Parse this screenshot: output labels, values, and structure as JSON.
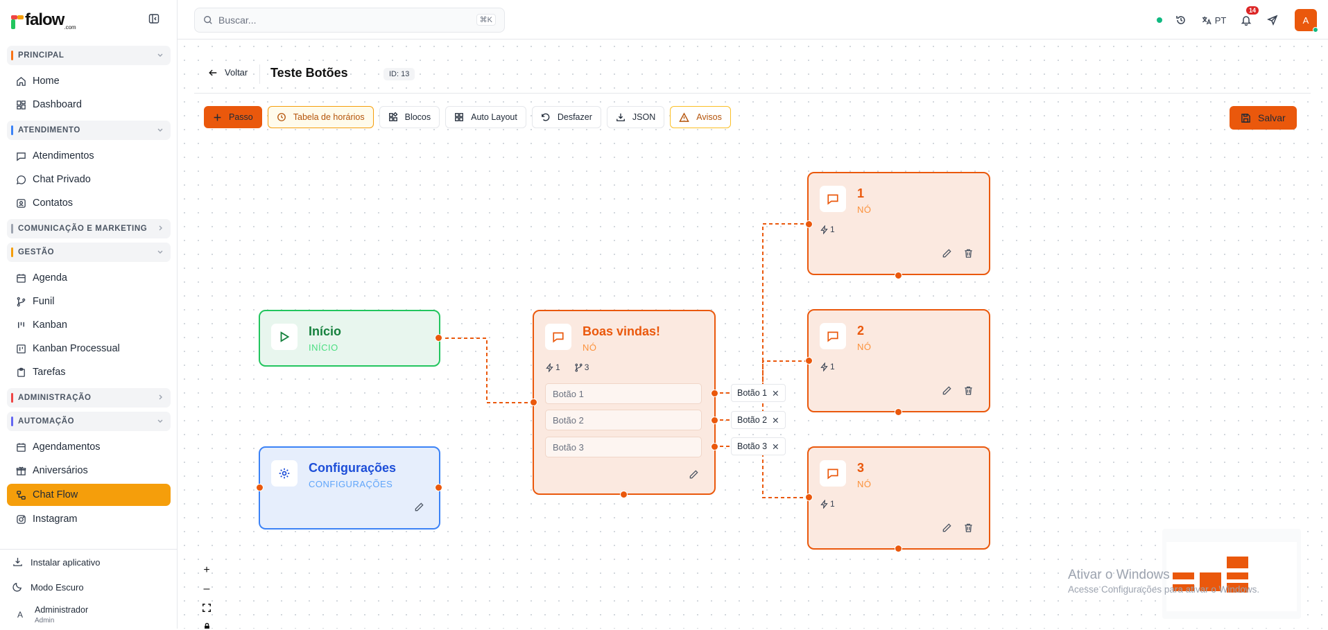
{
  "app": {
    "logo": "falow",
    "logo_suffix": ".com"
  },
  "sidebar": {
    "groups": [
      {
        "label": "PRINCIPAL",
        "color": "#f97316",
        "items": [
          {
            "label": "Home",
            "icon": "home-icon"
          },
          {
            "label": "Dashboard",
            "icon": "dashboard-icon"
          }
        ]
      },
      {
        "label": "ATENDIMENTO",
        "color": "#3b82f6",
        "items": [
          {
            "label": "Atendimentos",
            "icon": "message-square-icon"
          },
          {
            "label": "Chat Privado",
            "icon": "message-circle-icon"
          },
          {
            "label": "Contatos",
            "icon": "contacts-icon"
          }
        ]
      },
      {
        "label": "COMUNICAÇÃO E MARKETING",
        "color": "#9ca3af",
        "items": []
      },
      {
        "label": "GESTÃO",
        "color": "#f59e0b",
        "items": [
          {
            "label": "Agenda",
            "icon": "calendar-icon"
          },
          {
            "label": "Funil",
            "icon": "git-branch-icon"
          },
          {
            "label": "Kanban",
            "icon": "kanban-icon"
          },
          {
            "label": "Kanban Processual",
            "icon": "kanban-board-icon"
          },
          {
            "label": "Tarefas",
            "icon": "clipboard-icon"
          }
        ]
      },
      {
        "label": "ADMINISTRAÇÃO",
        "color": "#ef4444",
        "items": []
      },
      {
        "label": "AUTOMAÇÃO",
        "color": "#6366f1",
        "items": [
          {
            "label": "Agendamentos",
            "icon": "calendar-icon"
          },
          {
            "label": "Aniversários",
            "icon": "gift-icon"
          },
          {
            "label": "Chat Flow",
            "icon": "workflow-icon",
            "active": true
          },
          {
            "label": "Instagram",
            "icon": "instagram-icon"
          }
        ]
      }
    ],
    "install_label": "Instalar aplicativo",
    "dark_label": "Modo Escuro",
    "user": {
      "initial": "A",
      "name": "Administrador",
      "role": "Admin"
    }
  },
  "topbar": {
    "search_placeholder": "Buscar...",
    "search_shortcut": "⌘K",
    "language": "PT",
    "notifications": "14",
    "avatar": "A"
  },
  "page": {
    "back_label": "Voltar",
    "title": "Teste Botões",
    "id_badge": "ID: 13",
    "toolbar": {
      "passo": "Passo",
      "tabela": "Tabela de horários",
      "blocos": "Blocos",
      "auto_layout": "Auto Layout",
      "desfazer": "Desfazer",
      "json": "JSON",
      "avisos": "Avisos"
    },
    "save_label": "Salvar"
  },
  "flow": {
    "inicio": {
      "title": "Início",
      "subtitle": "INÍCIO"
    },
    "config": {
      "title": "Configurações",
      "subtitle": "CONFIGURAÇÕES"
    },
    "boas_vindas": {
      "title": "Boas vindas!",
      "subtitle": "NÓ",
      "triggers": "1",
      "branches": "3",
      "options": [
        "Botão 1",
        "Botão 2",
        "Botão 3"
      ]
    },
    "node1": {
      "title": "1",
      "subtitle": "NÓ",
      "triggers": "1"
    },
    "node2": {
      "title": "2",
      "subtitle": "NÓ",
      "triggers": "1"
    },
    "node3": {
      "title": "3",
      "subtitle": "NÓ",
      "triggers": "1"
    },
    "edge_labels": [
      "Botão 1",
      "Botão 2",
      "Botão 3"
    ]
  },
  "watermark": {
    "title": "Ativar o Windows",
    "subtitle": "Acesse Configurações para ativar o Windows."
  },
  "colors": {
    "accent": "#ea580c",
    "start": "#22c55e",
    "config": "#3b82f6",
    "active_nav": "#f59e0b"
  }
}
